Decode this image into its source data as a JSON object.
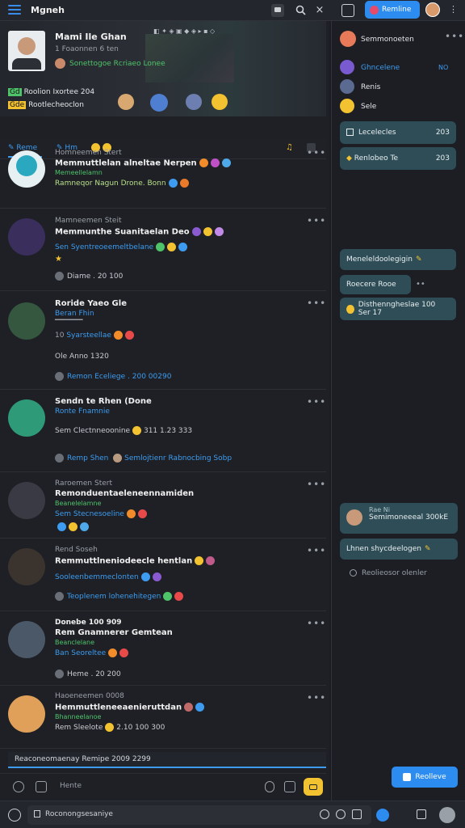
{
  "app": {
    "title": "Mgneh"
  },
  "topbar": {
    "active_button": "Remline"
  },
  "banner": {
    "name": "Mami Ile Ghan",
    "line2": "1 Foaonnen 6 ten",
    "line3": "Sonettogoe Rcriaeo Lonee",
    "stat1": "Roolion Ixortee 204",
    "stat2": "Rootlecheoclon",
    "badges": [
      "Gd",
      "Gde"
    ]
  },
  "tabs": {
    "first": "Reme",
    "second": "Hm"
  },
  "posts": [
    {
      "meta": "Homneemen Stert",
      "title": "Memmuttlelan alneltae Nerpen",
      "sub": "Memeellelamn",
      "detail": "Ramneqor Nagun Drone. Bonn"
    },
    {
      "meta": "Mamneemen Steit",
      "title": "Memmunthe Suanitaelan Deo",
      "sub": "",
      "detail": "Sen Syentreoeemeltbelane",
      "footer": "Diame . 20 100"
    },
    {
      "meta": "Roride Yaeo Gle",
      "title": "",
      "sub": "Beran Fhin",
      "detail": "Syarsteellae",
      "line4": "Ole Anno 1320",
      "footer": "Remon Eceliege . 200 00290"
    },
    {
      "meta": "Sendn te Rhen (Done",
      "title": "",
      "sub": "Ronte Fnamnie",
      "detail": "Sem Clectnneoonine",
      "value": "311 1.23 333",
      "footer": "Remp Shen",
      "footer2": "Semlojtienr Rabnocbing Sobp"
    },
    {
      "meta": "Raroemen Stert",
      "title": "Remonduentaeleneennamiden",
      "sub": "Beanelelamne",
      "detail": "Sem Stecnesoeline"
    },
    {
      "meta": "Rend Soseh",
      "title": "Remmuttlneniodeecle hentlan",
      "sub": "Sooleenbemmeclonten",
      "footer": "Teoplenem lohenehitegen"
    },
    {
      "meta": "Donebe 100 909",
      "title": "Rem Gnamnerer Gemtean",
      "sub": "Beanclelane",
      "detail": "Ban Seoreltee",
      "footer": "Heme . 20 200"
    },
    {
      "meta": "Haoeneemen 0008",
      "title": "Hemmuttleneeaenieruttdan",
      "sub": "Bhanneelanoe",
      "detail": "Rem Sleelote",
      "value": "2.10 100 300"
    }
  ],
  "bottom_status": "Reaconeomaenay Remipe 2009 2299",
  "composer": {
    "placeholder": "Hente"
  },
  "searchbar": {
    "placeholder": "Roconongsesaniye"
  },
  "right": {
    "header": "Semmonoeten",
    "contacts": [
      {
        "name": "Ghncelene",
        "count": "NO"
      },
      {
        "name": "Renis"
      },
      {
        "name": "Sele"
      }
    ],
    "cards": [
      {
        "label": "Lecelecles",
        "value": "203"
      },
      {
        "label": "Renlobeo Te",
        "value": "203"
      }
    ],
    "messages": [
      "Meneleldoolegigin",
      "Roecere Rooe",
      "Disthenngheslae 100 Ser 17",
      "Semimoneeeal 300kE",
      "Lhnen shycdeelogen"
    ],
    "msg_head": "Rae Ni",
    "note": "Reolieosor olenler",
    "button": "Reolleve"
  }
}
